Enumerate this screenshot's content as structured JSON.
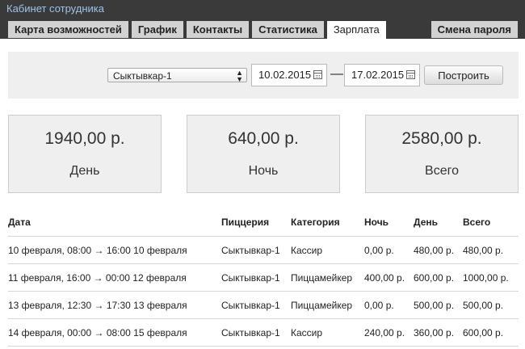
{
  "app": {
    "title": "Кабинет сотрудника"
  },
  "tabs": [
    {
      "label": "Карта возможностей"
    },
    {
      "label": "График"
    },
    {
      "label": "Контакты"
    },
    {
      "label": "Статистика"
    },
    {
      "label": "Зарплата",
      "active": true
    }
  ],
  "header_right": {
    "label": "Смена пароля"
  },
  "filters": {
    "pizzeria": "Сыктывкар-1",
    "date_from": "10.02.2015",
    "separator": "—",
    "date_to": "17.02.2015",
    "build_label": "Построить"
  },
  "summary": [
    {
      "amount": "1940,00 р.",
      "label": "День"
    },
    {
      "amount": "640,00 р.",
      "label": "Ночь"
    },
    {
      "amount": "2580,00 р.",
      "label": "Всего"
    }
  ],
  "table": {
    "headers": [
      "Дата",
      "Пиццерия",
      "Категория",
      "Ночь",
      "День",
      "Всего"
    ],
    "rows": [
      [
        "10 февраля, 08:00 → 16:00 10 февраля",
        "Сыктывкар-1",
        "Кассир",
        "0,00 р.",
        "480,00 р.",
        "480,00 р."
      ],
      [
        "11 февраля, 16:00 → 00:00 12 февраля",
        "Сыктывкар-1",
        "Пиццамейкер",
        "400,00 р.",
        "600,00 р.",
        "1000,00 р."
      ],
      [
        "13 февраля, 12:30 → 17:30 13 февраля",
        "Сыктывкар-1",
        "Пиццамейкер",
        "0,00 р.",
        "500,00 р.",
        "500,00 р."
      ],
      [
        "14 февраля, 00:00 → 08:00 15 февраля",
        "Сыктывкар-1",
        "Кассир",
        "240,00 р.",
        "360,00 р.",
        "600,00 р."
      ]
    ]
  }
}
